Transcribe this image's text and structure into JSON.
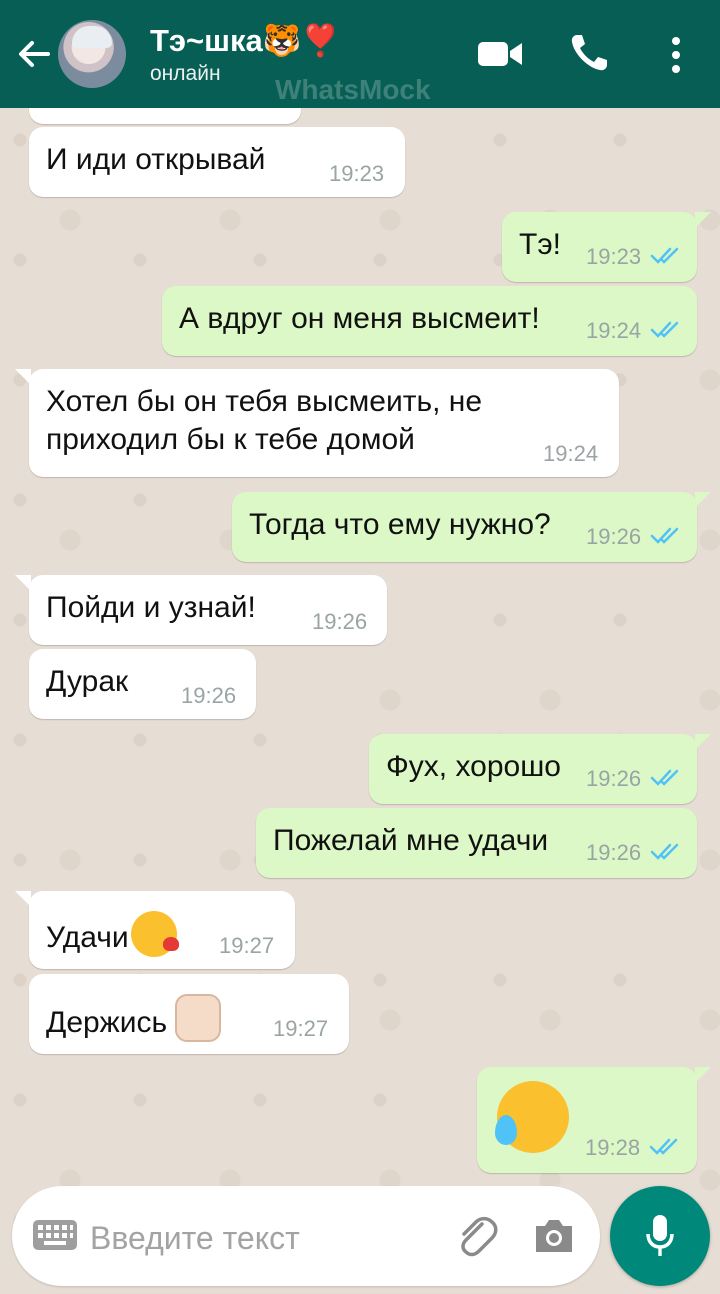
{
  "header": {
    "contact_name": "Тэ~шка🐯❣️",
    "status": "онлайн",
    "watermark": "WhatsMock",
    "icons": [
      "back-arrow-icon",
      "video-call-icon",
      "phone-icon",
      "more-vert-icon"
    ]
  },
  "messages": [
    {
      "dir": "in",
      "text": "И иди открывай",
      "time": "19:23"
    },
    {
      "dir": "out",
      "text": "Тэ!",
      "time": "19:23",
      "read": true
    },
    {
      "dir": "out",
      "text": "А вдруг он меня высмеит!",
      "time": "19:24",
      "read": true
    },
    {
      "dir": "in",
      "text_line1": "Хотел бы он тебя высмеить, не",
      "text_line2": "приходил бы к тебе домой",
      "time": "19:24"
    },
    {
      "dir": "out",
      "text": "Тогда что ему нужно?",
      "time": "19:26",
      "read": true
    },
    {
      "dir": "in",
      "text": "Пойди и узнай!",
      "time": "19:26"
    },
    {
      "dir": "in",
      "text": "Дурак",
      "time": "19:26"
    },
    {
      "dir": "out",
      "text": "Фух, хорошо",
      "time": "19:26",
      "read": true
    },
    {
      "dir": "out",
      "text": "Пожелай мне удачи",
      "time": "19:26",
      "read": true
    },
    {
      "dir": "in",
      "text": "Удачи",
      "emoji": "face-blowing-kiss",
      "time": "19:27"
    },
    {
      "dir": "in",
      "text": "Держись",
      "emoji": "raised-fist",
      "time": "19:27"
    },
    {
      "dir": "out",
      "emoji": "sad-sweat-face",
      "time": "19:28",
      "read": true
    }
  ],
  "input": {
    "placeholder": "Введите текст",
    "icons": [
      "keyboard-icon",
      "attach-icon",
      "camera-icon",
      "mic-icon"
    ]
  },
  "colors": {
    "header": "#075e54",
    "incoming": "#ffffff",
    "outgoing": "#dcf8c6",
    "read_ticks": "#4fc3f7",
    "mic_button": "#00897b",
    "background": "#e6ddd4"
  }
}
